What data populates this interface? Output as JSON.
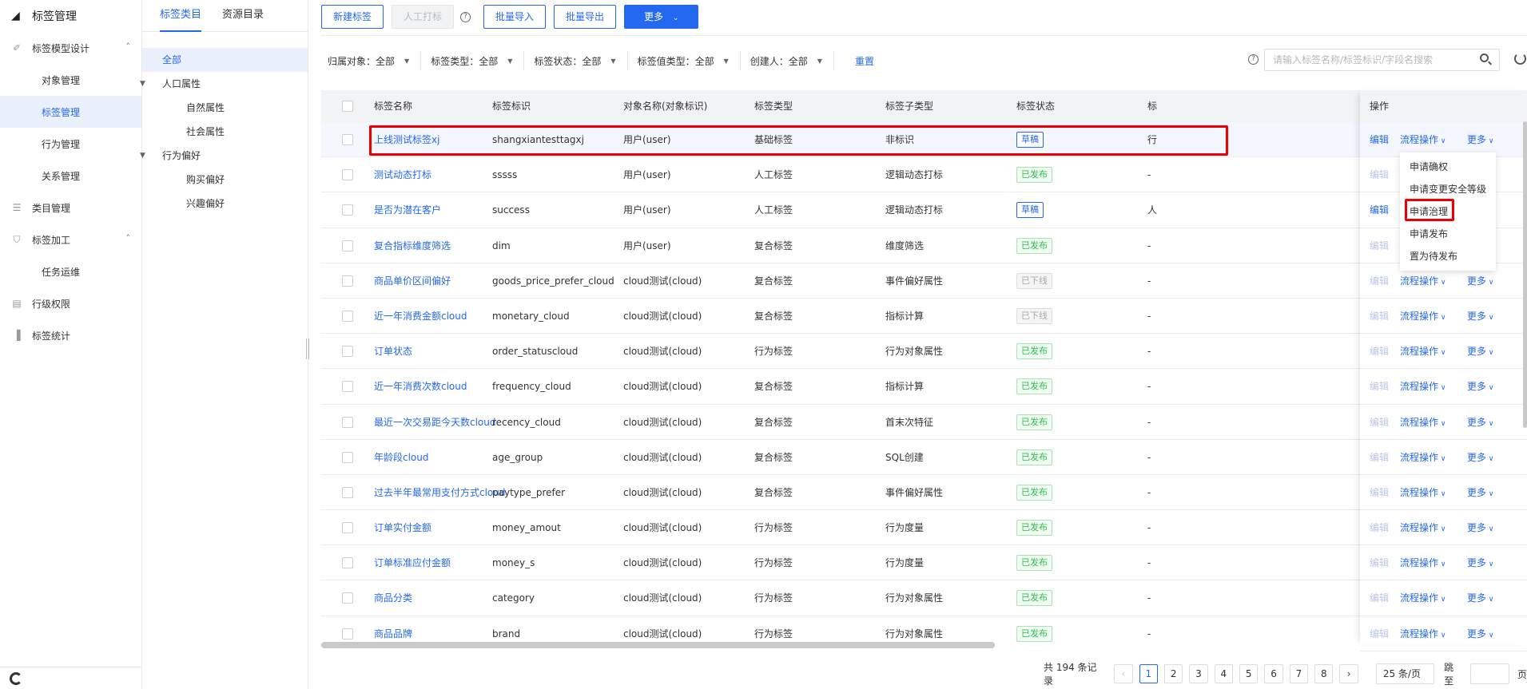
{
  "app": {
    "title": "标签管理",
    "logo_icon": "tag-icon"
  },
  "nav": [
    {
      "label": "标签模型设计",
      "icon": "design-icon",
      "expanded": true,
      "children": [
        "对象管理",
        "标签管理",
        "行为管理",
        "关系管理"
      ],
      "active_child": 1
    },
    {
      "label": "类目管理",
      "icon": "list-icon"
    },
    {
      "label": "标签加工",
      "icon": "shield-icon",
      "expanded": true,
      "children": [
        "任务运维"
      ]
    },
    {
      "label": "行级权限",
      "icon": "permission-icon"
    },
    {
      "label": "标签统计",
      "icon": "bar-chart-icon"
    }
  ],
  "tree_tabs": [
    "标签类目",
    "资源目录"
  ],
  "tree": [
    {
      "label": "全部",
      "level": 0,
      "active": true
    },
    {
      "label": "人口属性",
      "level": 0,
      "caret": true
    },
    {
      "label": "自然属性",
      "level": 1
    },
    {
      "label": "社会属性",
      "level": 1
    },
    {
      "label": "行为偏好",
      "level": 0,
      "caret": true
    },
    {
      "label": "购买偏好",
      "level": 1
    },
    {
      "label": "兴趣偏好",
      "level": 1
    }
  ],
  "toolbar": {
    "new": "新建标签",
    "manual": "人工打标",
    "import": "批量导入",
    "export": "批量导出",
    "more": "更多"
  },
  "filters": [
    {
      "label": "归属对象：",
      "value": "全部"
    },
    {
      "label": "标签类型：",
      "value": "全部"
    },
    {
      "label": "标签状态：",
      "value": "全部"
    },
    {
      "label": "标签值类型：",
      "value": "全部"
    },
    {
      "label": "创建人：",
      "value": "全部"
    }
  ],
  "reset": "重置",
  "search": {
    "placeholder": "请输入标签名称/标签标识/字段名搜索"
  },
  "columns": [
    "标签名称",
    "标签标识",
    "对象名称(对象标识)",
    "标签类型",
    "标签子类型",
    "标签状态",
    "标",
    "操作"
  ],
  "rows": [
    {
      "name": "上线测试标签xj",
      "id": "shangxiantesttagxj",
      "obj": "用户(user)",
      "type": "基础标签",
      "sub": "非标识",
      "status": "草稿",
      "st": "blue",
      "extra": "行",
      "edit_on": true,
      "show_flow": true
    },
    {
      "name": "测试动态打标",
      "id": "sssss",
      "obj": "用户(user)",
      "type": "人工标签",
      "sub": "逻辑动态打标",
      "status": "已发布",
      "st": "green",
      "extra": "-",
      "edit_on": false,
      "show_flow": false
    },
    {
      "name": "是否为潜在客户",
      "id": "success",
      "obj": "用户(user)",
      "type": "人工标签",
      "sub": "逻辑动态打标",
      "status": "草稿",
      "st": "blue",
      "extra": "人",
      "edit_on": true,
      "show_flow": false
    },
    {
      "name": "复合指标维度筛选",
      "id": "dim",
      "obj": "用户(user)",
      "type": "复合标签",
      "sub": "维度筛选",
      "status": "已发布",
      "st": "green",
      "extra": "-",
      "edit_on": false,
      "show_flow": false
    },
    {
      "name": "商品单价区间偏好",
      "id": "goods_price_prefer_cloud",
      "obj": "cloud测试(cloud)",
      "type": "复合标签",
      "sub": "事件偏好属性",
      "status": "已下线",
      "st": "gray",
      "extra": "-",
      "edit_on": false,
      "show_flow": true
    },
    {
      "name": "近一年消费金额cloud",
      "id": "monetary_cloud",
      "obj": "cloud测试(cloud)",
      "type": "复合标签",
      "sub": "指标计算",
      "status": "已下线",
      "st": "gray",
      "extra": "-",
      "edit_on": false,
      "show_flow": true
    },
    {
      "name": "订单状态",
      "id": "order_statuscloud",
      "obj": "cloud测试(cloud)",
      "type": "行为标签",
      "sub": "行为对象属性",
      "status": "已发布",
      "st": "green",
      "extra": "-",
      "edit_on": false,
      "show_flow": true
    },
    {
      "name": "近一年消费次数cloud",
      "id": "frequency_cloud",
      "obj": "cloud测试(cloud)",
      "type": "复合标签",
      "sub": "指标计算",
      "status": "已发布",
      "st": "green",
      "extra": "-",
      "edit_on": false,
      "show_flow": true
    },
    {
      "name": "最近一次交易距今天数cloud",
      "id": "recency_cloud",
      "obj": "cloud测试(cloud)",
      "type": "复合标签",
      "sub": "首末次特征",
      "status": "已发布",
      "st": "green",
      "extra": "-",
      "edit_on": false,
      "show_flow": true
    },
    {
      "name": "年龄段cloud",
      "id": "age_group",
      "obj": "cloud测试(cloud)",
      "type": "复合标签",
      "sub": "SQL创建",
      "status": "已发布",
      "st": "green",
      "extra": "-",
      "edit_on": false,
      "show_flow": true
    },
    {
      "name": "过去半年最常用支付方式cloud",
      "id": "paytype_prefer",
      "obj": "cloud测试(cloud)",
      "type": "复合标签",
      "sub": "事件偏好属性",
      "status": "已发布",
      "st": "green",
      "extra": "-",
      "edit_on": false,
      "show_flow": true
    },
    {
      "name": "订单实付金额",
      "id": "money_amout",
      "obj": "cloud测试(cloud)",
      "type": "行为标签",
      "sub": "行为度量",
      "status": "已发布",
      "st": "green",
      "extra": "-",
      "edit_on": false,
      "show_flow": true
    },
    {
      "name": "订单标准应付金额",
      "id": "money_s",
      "obj": "cloud测试(cloud)",
      "type": "行为标签",
      "sub": "行为度量",
      "status": "已发布",
      "st": "green",
      "extra": "-",
      "edit_on": false,
      "show_flow": true
    },
    {
      "name": "商品分类",
      "id": "category",
      "obj": "cloud测试(cloud)",
      "type": "行为标签",
      "sub": "行为对象属性",
      "status": "已发布",
      "st": "green",
      "extra": "-",
      "edit_on": false,
      "show_flow": true
    },
    {
      "name": "商品品牌",
      "id": "brand",
      "obj": "cloud测试(cloud)",
      "type": "行为标签",
      "sub": "行为对象属性",
      "status": "已发布",
      "st": "green",
      "extra": "-",
      "edit_on": false,
      "show_flow": true
    }
  ],
  "ops": {
    "edit": "编辑",
    "flow": "流程操作",
    "more": "更多"
  },
  "dropdown": [
    "申请确权",
    "申请变更安全等级",
    "申请治理",
    "申请发布",
    "置为待发布"
  ],
  "pagination": {
    "total": "共 194 条记录",
    "pages": [
      "1",
      "2",
      "3",
      "4",
      "5",
      "6",
      "7",
      "8"
    ],
    "current": "1",
    "page_size": "25 条/页",
    "jump": "跳至",
    "page_unit": "页"
  },
  "colors": {
    "primary": "#2468f2",
    "success": "#2fbf4c",
    "highlight": "#e00000"
  }
}
